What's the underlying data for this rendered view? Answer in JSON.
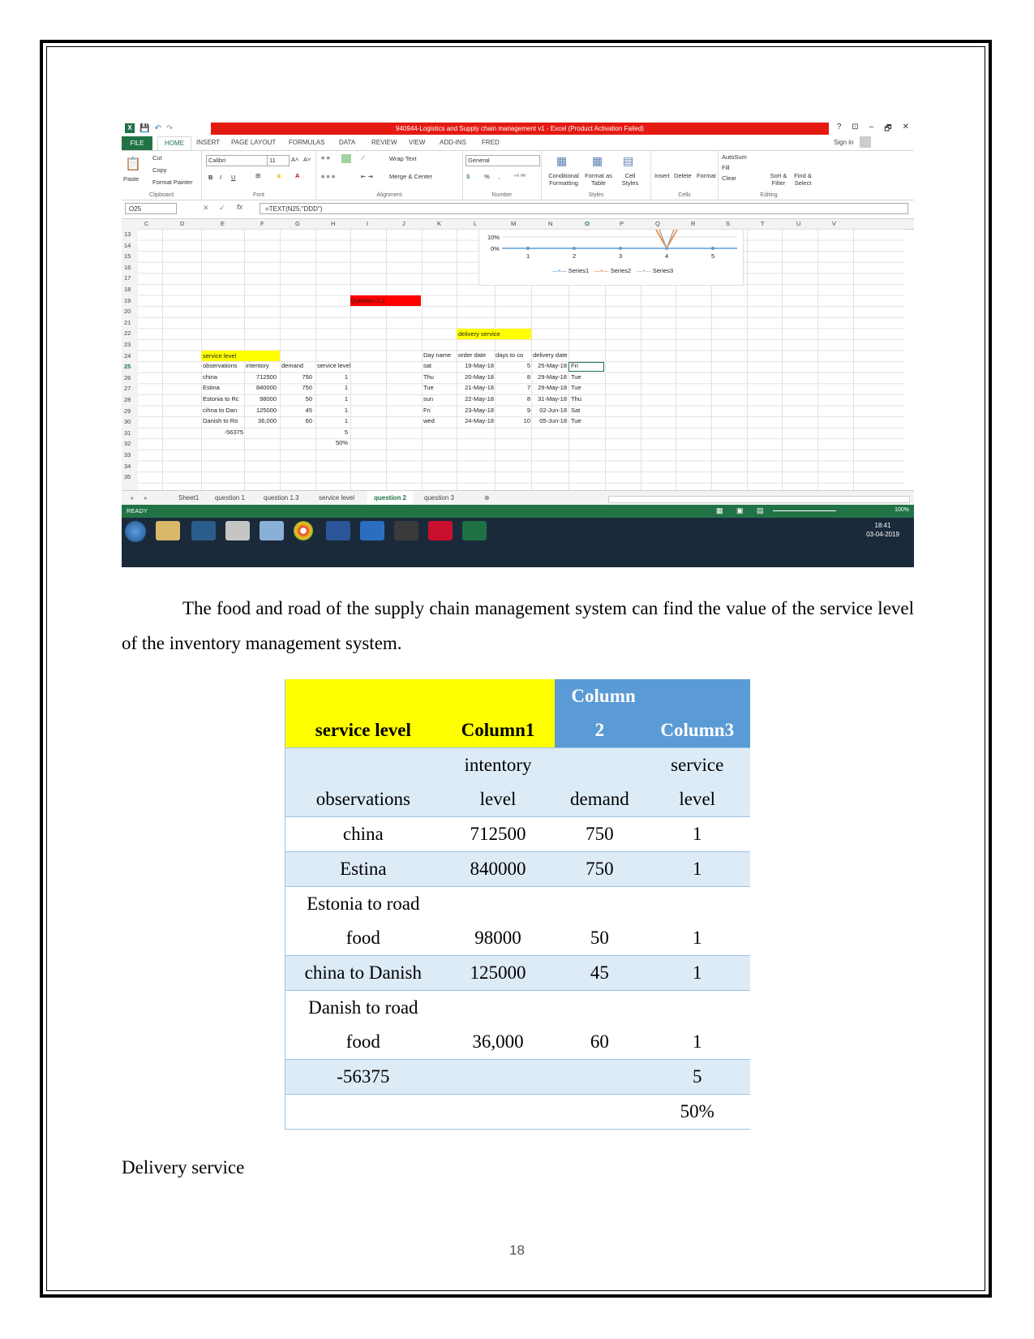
{
  "excel": {
    "window_title": "940944-Logistics and Supply chain management v1  -  Excel (Product Activation Failed)",
    "app_icon": "X",
    "window_controls": [
      "?",
      "⊡",
      "–",
      "🗗",
      "✕"
    ],
    "ribbon_tabs": [
      "FILE",
      "HOME",
      "INSERT",
      "PAGE LAYOUT",
      "FORMULAS",
      "DATA",
      "REVIEW",
      "VIEW",
      "ADD-INS",
      "FRED"
    ],
    "sign_in": "Sign in",
    "clipboard": {
      "paste": "Paste",
      "cut": "Cut",
      "copy": "Copy",
      "format_painter": "Format Painter",
      "caption": "Clipboard"
    },
    "font": {
      "name": "Calibri",
      "size": "11",
      "caption": "Font",
      "grow": "A˄",
      "shrink": "A˅",
      "bold": "B",
      "italic": "I",
      "underline": "U"
    },
    "alignment": {
      "wrap_text": "Wrap Text",
      "merge_center": "Merge & Center",
      "caption": "Alignment"
    },
    "number": {
      "format": "General",
      "caption": "Number",
      "percent": "%",
      "comma": "‚"
    },
    "styles": {
      "conditional": "Conditional Formatting",
      "format_table": "Format as Table",
      "cell_styles": "Cell Styles",
      "caption": "Styles"
    },
    "cells": {
      "insert": "Insert",
      "delete": "Delete",
      "format": "Format",
      "caption": "Cells"
    },
    "editing": {
      "autosum": "AutoSum",
      "fill": "Fill",
      "clear": "Clear",
      "sort_filter": "Sort & Filter",
      "find_select": "Find & Select",
      "caption": "Editing"
    },
    "name_box": "O25",
    "formula": "=TEXT(N25,\"DDD\")",
    "columns": [
      "C",
      "D",
      "E",
      "F",
      "G",
      "H",
      "I",
      "J",
      "K",
      "L",
      "M",
      "N",
      "O",
      "P",
      "Q",
      "R",
      "S",
      "T",
      "U",
      "V"
    ],
    "rows": [
      "13",
      "14",
      "15",
      "16",
      "17",
      "18",
      "19",
      "20",
      "21",
      "22",
      "23",
      "24",
      "25",
      "26",
      "27",
      "28",
      "29",
      "30",
      "31",
      "32",
      "33",
      "34",
      "35"
    ],
    "chart": {
      "y_ticks": [
        "10%",
        "0%"
      ],
      "x_ticks": [
        "1",
        "2",
        "3",
        "4",
        "5"
      ],
      "legend": [
        "Series1",
        "Series2",
        "Series3"
      ],
      "series_colors": [
        "#5b9bd5",
        "#ed7d31",
        "#a5a5a5"
      ]
    },
    "cells_text": {
      "question": "Question 2.2",
      "delivery_service": "delivery service",
      "service_level": "service level",
      "sl_header": [
        "observations",
        "intentory",
        "demand",
        "service level"
      ],
      "sl_rows": [
        [
          "china",
          "712500",
          "750",
          "1"
        ],
        [
          "Estina",
          "840000",
          "750",
          "1"
        ],
        [
          "Estonia to Rc",
          "98000",
          "50",
          "1"
        ],
        [
          "cihna to Dan",
          "125000",
          "45",
          "1"
        ],
        [
          "Danish to Ro",
          "36,000",
          "60",
          "1"
        ]
      ],
      "sl_total": "-56375",
      "sl_total_h": "5",
      "sl_pct": "50%",
      "ds_header": [
        "Day name",
        "order date",
        "days to co",
        "delivery date"
      ],
      "ds_rows": [
        [
          "sat",
          "19-May-18",
          "5",
          "25-May-18",
          "Fri"
        ],
        [
          "Thu",
          "20-May-18",
          "8",
          "29-May-18",
          "Tue"
        ],
        [
          "Tue",
          "21-May-18",
          "7",
          "29-May-18",
          "Tue"
        ],
        [
          "sun",
          "22-May-18",
          "8",
          "31-May-18",
          "Thu"
        ],
        [
          "Fri",
          "23-May-18",
          "9",
          "02-Jun-18",
          "Sat"
        ],
        [
          "wed",
          "24-May-18",
          "10",
          "05-Jun-18",
          "Tue"
        ]
      ]
    },
    "sheet_tabs": [
      "Sheet1",
      "question 1",
      "question 1.3",
      "service level",
      "question 2",
      "question 3"
    ],
    "active_sheet": "question 2",
    "status": "READY",
    "zoom": "100%",
    "clock_time": "18:41",
    "clock_date": "03-04-2019"
  },
  "paragraph": "The food and road of the supply chain management system can find the value of the service level of the inventory management system.",
  "table": {
    "headers": [
      "service level",
      "Column1",
      "Column 2",
      "Column3"
    ],
    "rows": [
      [
        "observations",
        "intentory level",
        "demand",
        "service level"
      ],
      [
        "china",
        "712500",
        "750",
        "1"
      ],
      [
        "Estina",
        "840000",
        "750",
        "1"
      ],
      [
        "Estonia to road food",
        "98000",
        "50",
        "1"
      ],
      [
        "china to Danish",
        "125000",
        "45",
        "1"
      ],
      [
        "Danish to road food",
        "36,000",
        "60",
        "1"
      ],
      [
        "-56375",
        "",
        "",
        "5"
      ],
      [
        "",
        "",
        "",
        "50%"
      ]
    ]
  },
  "section_heading": "Delivery service",
  "page_number": "18"
}
